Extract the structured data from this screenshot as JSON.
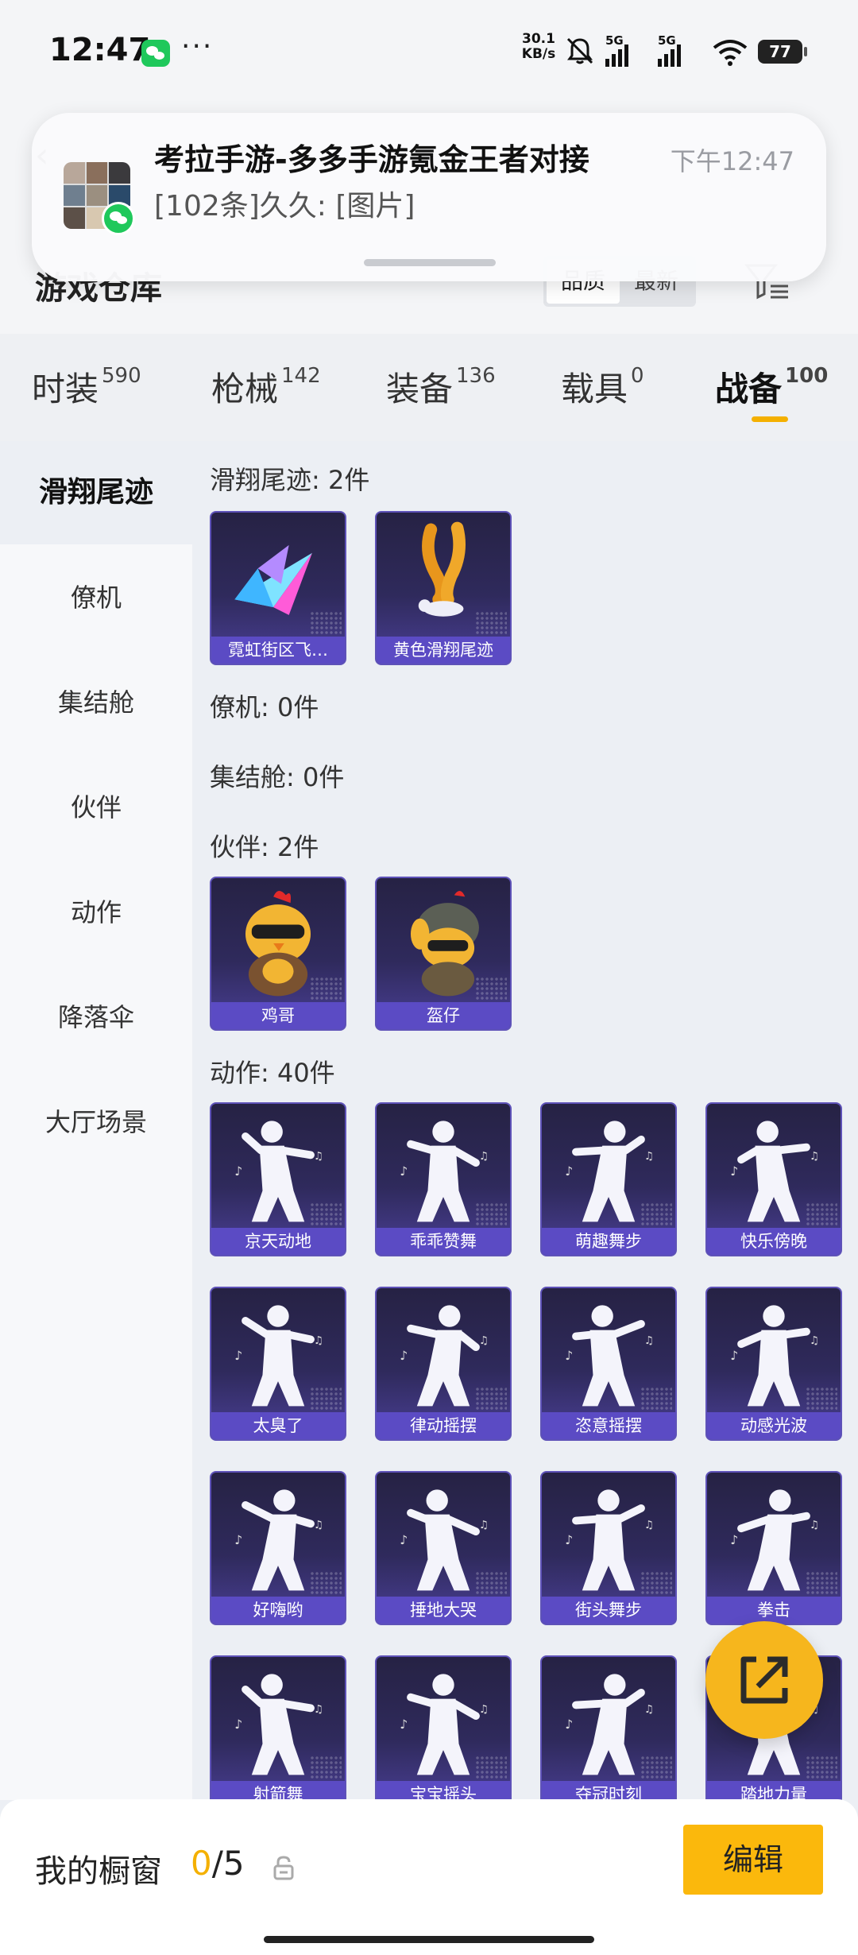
{
  "status": {
    "time": "12:47",
    "more": "···",
    "speed_value": "30.1",
    "speed_unit": "KB/s",
    "net1": "5G",
    "net2": "5G",
    "battery": "77"
  },
  "header": {
    "title": "游戏仓库",
    "sort_options": [
      "品质",
      "最新"
    ]
  },
  "notification": {
    "title": "考拉手游-多多手游氪金王者对接",
    "time": "下午12:47",
    "body": "[102条]久久: [图片]"
  },
  "tabs": [
    {
      "label": "时装",
      "count": "590"
    },
    {
      "label": "枪械",
      "count": "142"
    },
    {
      "label": "装备",
      "count": "136"
    },
    {
      "label": "载具",
      "count": "0"
    },
    {
      "label": "战备",
      "count": "100",
      "active": true
    }
  ],
  "sidebar": [
    {
      "label": "滑翔尾迹",
      "active": true
    },
    {
      "label": "僚机"
    },
    {
      "label": "集结舱"
    },
    {
      "label": "伙伴"
    },
    {
      "label": "动作"
    },
    {
      "label": "降落伞"
    },
    {
      "label": "大厅场景"
    }
  ],
  "sections": {
    "trail": {
      "title": "滑翔尾迹: 2件",
      "items": [
        "霓虹街区飞…",
        "黄色滑翔尾迹"
      ]
    },
    "wingman": {
      "title": "僚机: 0件"
    },
    "pod": {
      "title": "集结舱: 0件"
    },
    "partner": {
      "title": "伙伴: 2件",
      "items": [
        "鸡哥",
        "盔仔"
      ]
    },
    "emote": {
      "title": "动作: 40件",
      "items": [
        "京天动地",
        "乖乖赞舞",
        "萌趣舞步",
        "快乐傍晚",
        "太臭了",
        "律动摇摆",
        "恣意摇摆",
        "动感光波",
        "好嗨哟",
        "捶地大哭",
        "街头舞步",
        "拳击",
        "射箭舞",
        "宝宝摇头",
        "夺冠时刻",
        "踏地力量"
      ]
    }
  },
  "bottom": {
    "label": "我的橱窗",
    "count_used": "0",
    "count_total": "/5",
    "edit": "编辑"
  },
  "colors": {
    "accent": "#f4b000",
    "card_caption": "#5b4bc4",
    "card_bg": "#2f2a5c"
  }
}
